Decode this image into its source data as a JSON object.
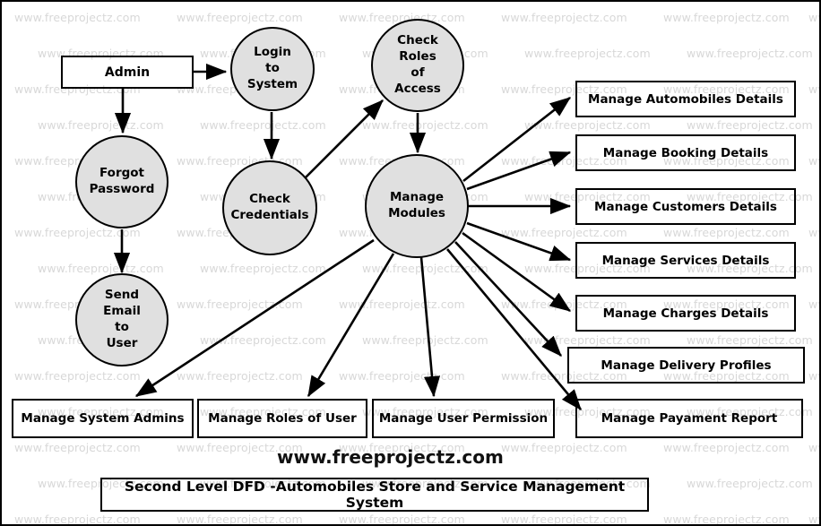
{
  "diagram": {
    "title": "Second Level DFD -Automobiles Store and Service Management System",
    "site_heading": "www.freeprojectz.com",
    "watermark_text": "www.freeprojectz.com",
    "colors": {
      "process_fill": "#e0e0e0",
      "stroke": "#000000",
      "watermark": "#d8d8d8",
      "background": "#ffffff"
    }
  },
  "entities": [
    {
      "id": "admin",
      "label": "Admin"
    }
  ],
  "processes": [
    {
      "id": "login_to_system",
      "label": "Login\nto\nSystem",
      "lines": [
        "Login",
        "to",
        "System"
      ]
    },
    {
      "id": "check_roles_of_access",
      "label": "Check Roles of Access",
      "lines": [
        "Check",
        "Roles",
        "of",
        "Access"
      ]
    },
    {
      "id": "forgot_password",
      "label": "Forgot Password",
      "lines": [
        "Forgot",
        "Password"
      ]
    },
    {
      "id": "check_credentials",
      "label": "Check Credentials",
      "lines": [
        "Check",
        "Credentials"
      ]
    },
    {
      "id": "send_email_to_user",
      "label": "Send Email to User",
      "lines": [
        "Send",
        "Email",
        "to",
        "User"
      ]
    },
    {
      "id": "manage_modules",
      "label": "Manage Modules",
      "lines": [
        "Manage",
        "Modules"
      ]
    }
  ],
  "module_boxes": [
    {
      "id": "manage_automobiles_details",
      "label": "Manage Automobiles Details"
    },
    {
      "id": "manage_booking_details",
      "label": "Manage Booking Details"
    },
    {
      "id": "manage_customers_details",
      "label": "Manage Customers Details"
    },
    {
      "id": "manage_services_details",
      "label": "Manage Services Details"
    },
    {
      "id": "manage_charges_details",
      "label": "Manage Charges Details"
    },
    {
      "id": "manage_delivery_profiles",
      "label": "Manage Delivery Profiles"
    },
    {
      "id": "manage_payment_report",
      "label": "Manage Payament Report"
    },
    {
      "id": "manage_system_admins",
      "label": "Manage System Admins"
    },
    {
      "id": "manage_roles_of_user",
      "label": "Manage Roles of User"
    },
    {
      "id": "manage_user_permission",
      "label": "Manage User Permission"
    }
  ],
  "flows": [
    {
      "from": "admin",
      "to": "login_to_system"
    },
    {
      "from": "admin",
      "to": "forgot_password"
    },
    {
      "from": "forgot_password",
      "to": "send_email_to_user"
    },
    {
      "from": "login_to_system",
      "to": "check_credentials"
    },
    {
      "from": "check_credentials",
      "to": "check_roles_of_access"
    },
    {
      "from": "check_roles_of_access",
      "to": "manage_modules"
    },
    {
      "from": "manage_modules",
      "to": "manage_automobiles_details"
    },
    {
      "from": "manage_modules",
      "to": "manage_booking_details"
    },
    {
      "from": "manage_modules",
      "to": "manage_customers_details"
    },
    {
      "from": "manage_modules",
      "to": "manage_services_details"
    },
    {
      "from": "manage_modules",
      "to": "manage_charges_details"
    },
    {
      "from": "manage_modules",
      "to": "manage_delivery_profiles"
    },
    {
      "from": "manage_modules",
      "to": "manage_payment_report"
    },
    {
      "from": "manage_modules",
      "to": "manage_system_admins"
    },
    {
      "from": "manage_modules",
      "to": "manage_roles_of_user"
    },
    {
      "from": "manage_modules",
      "to": "manage_user_permission"
    }
  ]
}
